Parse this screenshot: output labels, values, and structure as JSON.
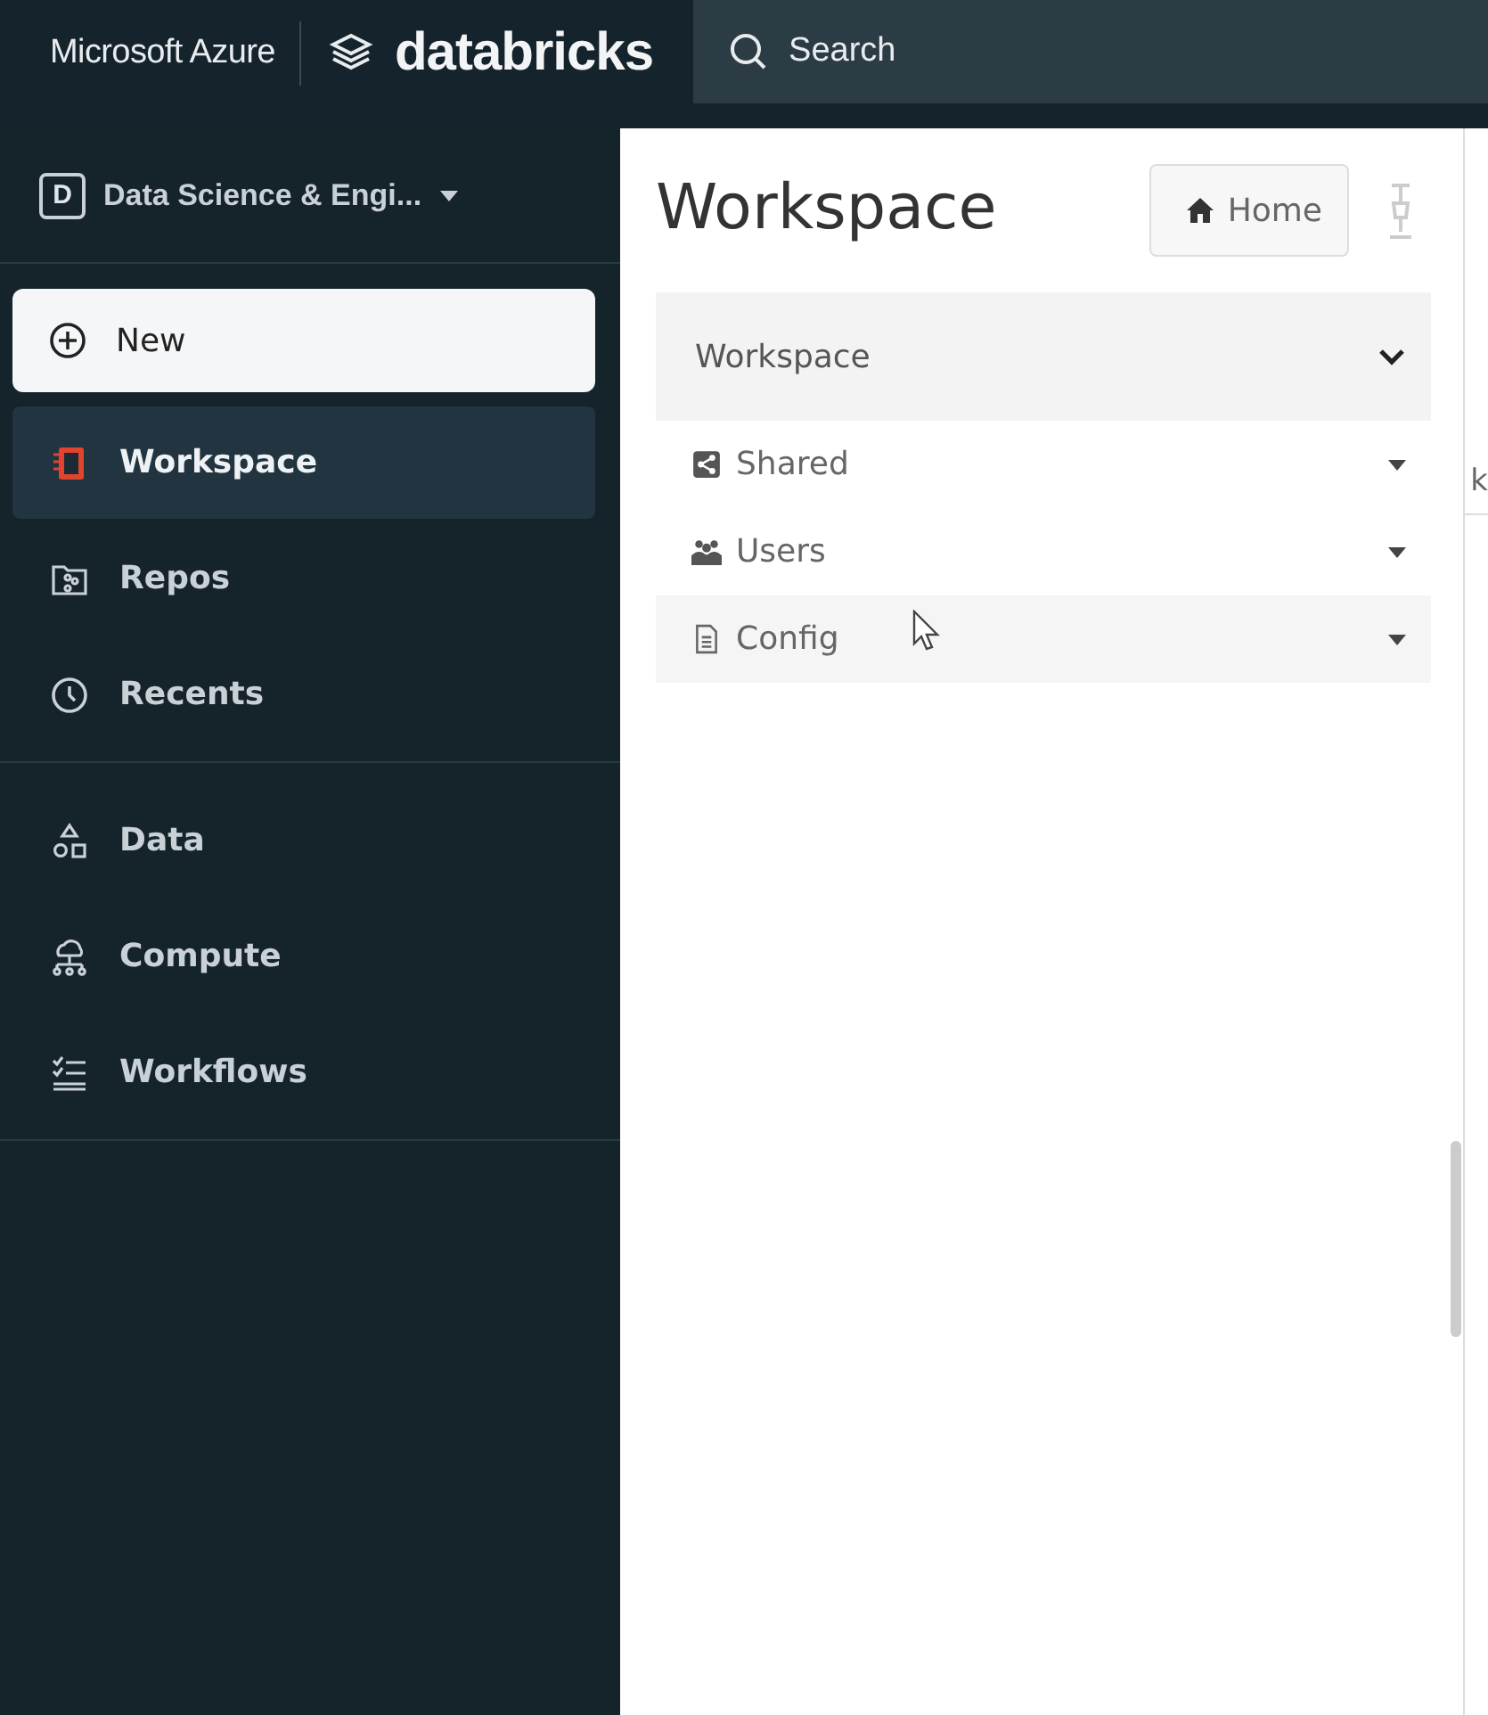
{
  "top_bar": {
    "brand": "Microsoft Azure",
    "product": "databricks",
    "search": {
      "placeholder": "Search"
    }
  },
  "sidebar": {
    "persona": {
      "badge": "D",
      "label": "Data Science & Engi..."
    },
    "new_button": {
      "label": "New"
    },
    "groups": [
      {
        "items": [
          {
            "label": "Workspace",
            "kind": "workspace",
            "selected": true
          },
          {
            "label": "Repos",
            "kind": "repos",
            "selected": false
          },
          {
            "label": "Recents",
            "kind": "recents",
            "selected": false
          }
        ]
      },
      {
        "items": [
          {
            "label": "Data",
            "kind": "data",
            "selected": false
          },
          {
            "label": "Compute",
            "kind": "compute",
            "selected": false
          },
          {
            "label": "Workflows",
            "kind": "workflows",
            "selected": false
          }
        ]
      }
    ]
  },
  "panel": {
    "title": "Workspace",
    "home_button": {
      "label": "Home"
    },
    "tree": {
      "label": "Workspace",
      "expanded": true,
      "children": [
        {
          "label": "Shared",
          "kind": "shared",
          "hovered": false
        },
        {
          "label": "Users",
          "kind": "users",
          "hovered": false
        },
        {
          "label": "Config",
          "kind": "file",
          "hovered": true
        }
      ]
    }
  },
  "background_text": "k"
}
